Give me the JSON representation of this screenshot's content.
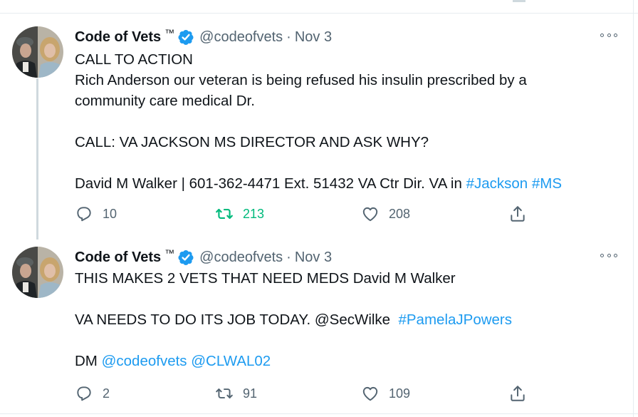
{
  "tweets": [
    {
      "author": {
        "name": "Code of Vets",
        "trademark": "™",
        "handle": "@codeofvets",
        "separator": "·",
        "date": "Nov 3"
      },
      "body": {
        "line1": "CALL TO ACTION",
        "line2": "Rich Anderson our veteran is being refused his insulin prescribed by a",
        "line3": "community care medical Dr.",
        "line4": "CALL: VA JACKSON MS DIRECTOR AND ASK WHY?",
        "line5_prefix": "David M Walker | 601-362-4471 Ext. 51432 VA Ctr Dir. VA in ",
        "hashtag1": "#Jackson",
        "hashtag2": "#MS"
      },
      "stats": {
        "replies": "10",
        "retweets": "213",
        "likes": "208"
      },
      "retweeted": true
    },
    {
      "author": {
        "name": "Code of Vets",
        "trademark": "™",
        "handle": "@codeofvets",
        "separator": "·",
        "date": "Nov 3"
      },
      "body": {
        "line1": "THIS MAKES 2 VETS THAT NEED MEDS David M Walker",
        "line2_prefix": "VA NEEDS TO DO ITS JOB TODAY. @SecWilke  ",
        "hashtag1": "#PamelaJPowers",
        "line3_prefix": "DM ",
        "mention1": "@codeofvets",
        "mention2": "@CLWAL02"
      },
      "stats": {
        "replies": "2",
        "retweets": "91",
        "likes": "109"
      },
      "retweeted": false
    }
  ],
  "colors": {
    "accent": "#1d9bf0",
    "retweet_active": "#00ba7c",
    "secondary_text": "#536471",
    "primary_text": "#0f1419",
    "thread_line": "#cfd9de"
  },
  "icons": [
    "avatar",
    "verified-badge-icon",
    "more-options-icon",
    "reply-icon",
    "retweet-icon",
    "like-icon",
    "share-icon"
  ]
}
